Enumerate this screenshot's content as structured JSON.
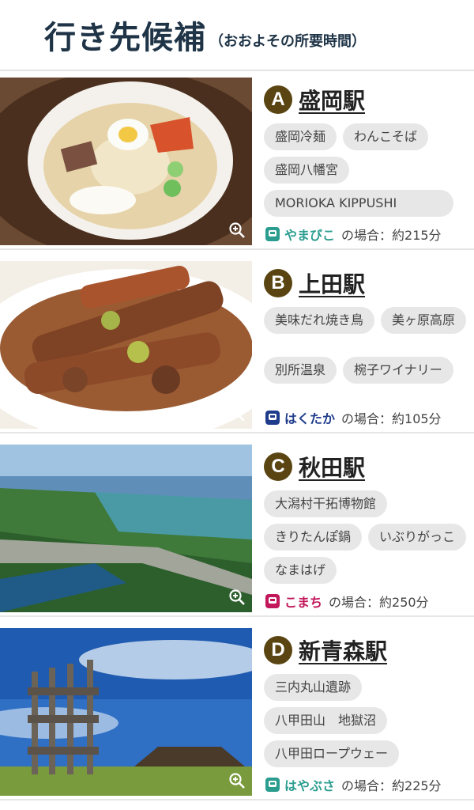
{
  "header": {
    "title": "行き先候補",
    "subtitle": "（おおよその所要時間）"
  },
  "destinations": [
    {
      "letter": "A",
      "station": "盛岡駅",
      "tags": [
        "盛岡冷麺",
        "わんこそば",
        "盛岡八幡宮",
        "MORIOKA KIPPUSHI"
      ],
      "train": "やまびこ",
      "train_color": "#2a9d8f",
      "duration_text": "の場合：約215分",
      "photo_icon": "cold-noodle-photo"
    },
    {
      "letter": "B",
      "station": "上田駅",
      "tags": [
        "美味だれ焼き鳥",
        "美ヶ原高原",
        "別所温泉",
        "椀子ワイナリー"
      ],
      "train": "はくたか",
      "train_color": "#1f3c8c",
      "duration_text": "の場合：約105分",
      "photo_icon": "yakitori-photo"
    },
    {
      "letter": "C",
      "station": "秋田駅",
      "tags": [
        "大潟村干拓博物館",
        "きりたんぽ鍋",
        "いぶりがっこ",
        "なまはげ"
      ],
      "train": "こまち",
      "train_color": "#c2185b",
      "duration_text": "の場合：約250分",
      "photo_icon": "aerial-photo"
    },
    {
      "letter": "D",
      "station": "新青森駅",
      "tags": [
        "三内丸山遺跡",
        "八甲田山　地獄沼",
        "八甲田ロープウェー"
      ],
      "train": "はやぶさ",
      "train_color": "#2a9d8f",
      "duration_text": "の場合：約225分",
      "photo_icon": "ruins-photo"
    }
  ]
}
